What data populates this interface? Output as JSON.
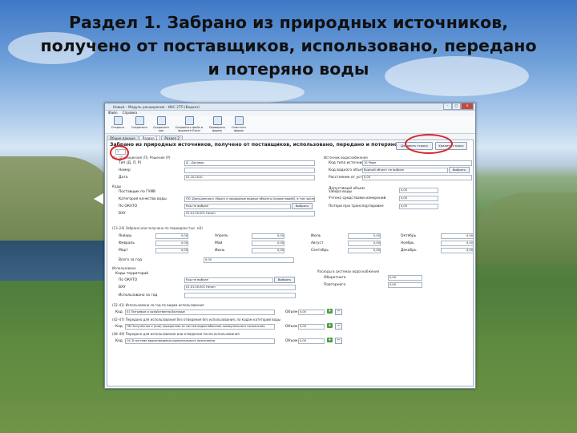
{
  "slide_title": "Раздел 1. Забрано из природных источников, получено от поставщиков, использовано, передано и потеряно воды",
  "window": {
    "title": "Новый – Модуль расширения – ИАС 2ТП (Водхоз)",
    "menu": [
      "Файл",
      "Справка"
    ],
    "toolbar": [
      "Открыть",
      "Сохранить",
      "Сохранить как",
      "Сохранить файл в формате Excel",
      "Проверить форму",
      "Очистить форму"
    ],
    "tabs": [
      "Общие данные",
      "Раздел 1",
      "Раздел 2"
    ]
  },
  "section": {
    "heading": "Забрано из природных источников, получено от поставщиков, использовано, передано и потеряно воды",
    "add_row": "Добавить строку",
    "delete_row": "Удалить строку",
    "row_number": "1",
    "license_group": "(1), (2), Лицензия (Л), Решение (Р)",
    "type_label": "Тип (Д, Л, Р)",
    "type_value": "Д – Договор",
    "number_label": "Номер",
    "date_label": "Дата",
    "date_value": "01.10.2010",
    "codes_label": "Коды",
    "supplier_label": "Поставщик по ГУИВ",
    "water_category_label": "Категория качества воды",
    "water_category_value": "ПО: Допущенная к сбросу в природные водные объекты (кроме морей), в том числе после",
    "okato_label": "По ОКАТО",
    "okato_value": "Код не выбран",
    "vku_label": "ВХУ",
    "vku_value": "01.01.00.001 Нечен",
    "select_label": "Выбрать",
    "source_group": "Источник водоснабжения",
    "source_type_label": "Код типа источника",
    "source_type_value": "10 Море",
    "water_object_label": "Код водного объекта",
    "water_object_value": "Водный объект не выбран",
    "distance_label": "Расстояние от устья, км",
    "distance_value": "0,00",
    "allowed_label": "Допустимый объем забора воды",
    "allowed_value": "0,00",
    "accounted_label": "Учтено средствами измерений",
    "accounted_value": "0,00",
    "losses_label": "Потери при транспортировке",
    "losses_value": "0,00",
    "monthly_group": "(13–24) Забрано или получено по периодам (тыс. м3)",
    "months": [
      {
        "name": "Январь",
        "value": "0,00"
      },
      {
        "name": "Апрель",
        "value": "0,00"
      },
      {
        "name": "Июль",
        "value": "0,00"
      },
      {
        "name": "Октябрь",
        "value": "0,00"
      },
      {
        "name": "Февраль",
        "value": "0,00"
      },
      {
        "name": "Май",
        "value": "0,00"
      },
      {
        "name": "Август",
        "value": "0,00"
      },
      {
        "name": "Ноябрь",
        "value": "0,00"
      },
      {
        "name": "Март",
        "value": "0,00"
      },
      {
        "name": "Июнь",
        "value": "0,00"
      },
      {
        "name": "Сентябрь",
        "value": "0,00"
      },
      {
        "name": "Декабрь",
        "value": "0,00"
      }
    ],
    "total_label": "Всего за год",
    "total_value": "0,00",
    "usage_label": "Использовано",
    "territory_label": "Коды территорий",
    "t_okato_label": "По ОКАТО",
    "t_okato_value": "Код не выбран",
    "t_vku_label": "ВХУ",
    "t_vku_value": "01.01.00.001 Нечен",
    "used_year_label": "Использовано за год",
    "recycle_group": "Расходы в системах водоснабжения",
    "circulating_label": "Оборотного",
    "circulating_value": "0,00",
    "repeated_label": "Повторного",
    "repeated_value": "0,00",
    "purpose_group_1": "(32–41) Использовано за год по видам использования",
    "code_label": "Код",
    "code_value_1": "01 Питьевые и хозяйственно-бытовые",
    "volume_label": "Объем",
    "volume_value": "0,00",
    "purpose_group_2": "(42–47) Передано для использования без отведения без использования, по кодам категорий воды",
    "code_value_2": "ПК Полученная и (или) переданная из систем водоснабжения коммунального назначения",
    "purpose_group_3": "(48–49) Передано для использования или отведения после использования",
    "code_value_3": "ОС В системе водоотведения коммунального назначения"
  }
}
